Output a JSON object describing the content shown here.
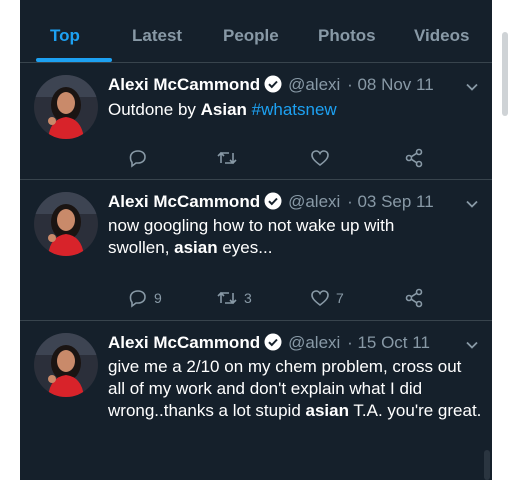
{
  "tabs": [
    "Top",
    "Latest",
    "People",
    "Photos",
    "Videos"
  ],
  "active_tab": "Top",
  "colors": {
    "background": "#15202b",
    "accent": "#1da1f2",
    "muted": "#8899a6",
    "divider": "#38444d"
  },
  "tweets": [
    {
      "author": "Alexi McCammond",
      "handle": "@alexi",
      "date": "· 08 Nov 11",
      "text": {
        "t1": "Outdone by ",
        "bold1": "Asian",
        "t2": " ",
        "hashtag": "#whatsnew"
      },
      "replies": "",
      "retweets": "",
      "likes": ""
    },
    {
      "author": "Alexi McCammond",
      "handle": "@alexi",
      "date": "· 03 Sep 11",
      "text": {
        "t1": "now googling how to not wake up with swollen, ",
        "bold1": "asian",
        "t2": " eyes..."
      },
      "replies": "9",
      "retweets": "3",
      "likes": "7"
    },
    {
      "author": "Alexi McCammond",
      "handle": "@alexi",
      "date": "· 15 Oct 11",
      "text": {
        "t1": "give me a 2/10 on my chem problem, cross out all of my work and don't explain what I did wrong..thanks a lot stupid ",
        "bold1": "asian",
        "t2": " T.A. you're great."
      }
    }
  ],
  "icons": [
    "verified-badge-icon",
    "chevron-down-icon",
    "reply-icon",
    "retweet-icon",
    "like-icon",
    "share-icon"
  ]
}
